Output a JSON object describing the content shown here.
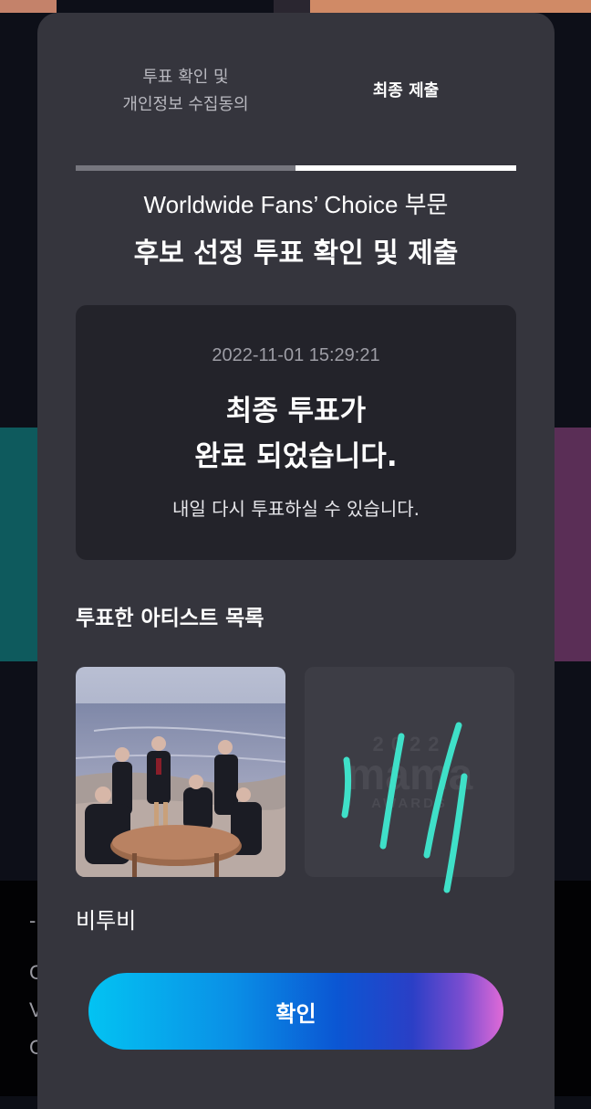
{
  "tabs": [
    {
      "label_line1": "투표 확인 및",
      "label_line2": "개인정보 수집동의"
    },
    {
      "label": "최종 제출"
    }
  ],
  "category": "Worldwide Fans’ Choice 부문",
  "heading": "후보 선정 투표 확인 및 제출",
  "result": {
    "timestamp": "2022-11-01 15:29:21",
    "message_line1": "최종 투표가",
    "message_line2": "완료 되었습니다.",
    "sub": "내일 다시 투표하실 수 있습니다."
  },
  "voted_section": {
    "title": "투표한 아티스트 목록",
    "artists": [
      {
        "name": "비투비",
        "image": "group-photo"
      },
      {
        "name": "",
        "image": "mama-awards-placeholder",
        "placeholder_text_top": "2022",
        "placeholder_text_main": "mama",
        "placeholder_text_bottom": "AWARDS"
      }
    ]
  },
  "confirm_label": "확인",
  "colors": {
    "modal_bg": "#35353d",
    "card_bg": "#23232a",
    "active_tab": "#ffffff",
    "inactive_tab": "#76767e",
    "button_gradient_start": "#03c3f2",
    "button_gradient_mid": "#0b56d3",
    "button_gradient_end": "#e06ad7",
    "scribble": "#3fe0c8"
  },
  "background_peek": [
    "-",
    "C",
    "V",
    "C"
  ]
}
